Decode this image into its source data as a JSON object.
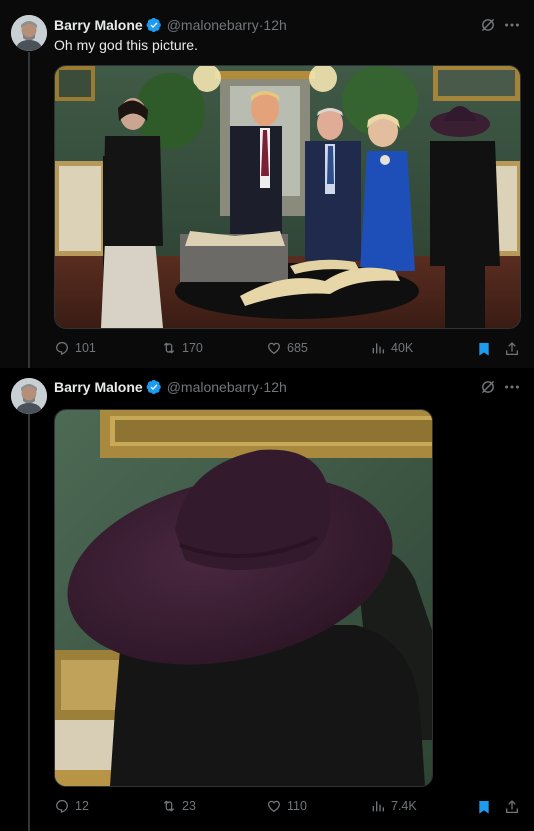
{
  "tweets": [
    {
      "author": "Barry Malone",
      "handle": "@malonebarry",
      "time": "12h",
      "text": "Oh my god this picture.",
      "stats": {
        "replies": "101",
        "reposts": "170",
        "likes": "685",
        "views": "40K"
      },
      "bookmarked": true
    },
    {
      "author": "Barry Malone",
      "handle": "@malonebarry",
      "time": "12h",
      "text": "",
      "stats": {
        "replies": "12",
        "reposts": "23",
        "likes": "110",
        "views": "7.4K"
      },
      "bookmarked": true
    }
  ],
  "separator": " · ",
  "colors": {
    "accent": "#1d9bf0",
    "muted": "#71767b",
    "text": "#e7e9ea",
    "hat": "#3a1f33"
  },
  "icons": [
    "verified-badge-icon",
    "grok-icon",
    "more-icon",
    "reply-icon",
    "repost-icon",
    "like-icon",
    "views-icon",
    "bookmark-icon",
    "share-icon"
  ]
}
